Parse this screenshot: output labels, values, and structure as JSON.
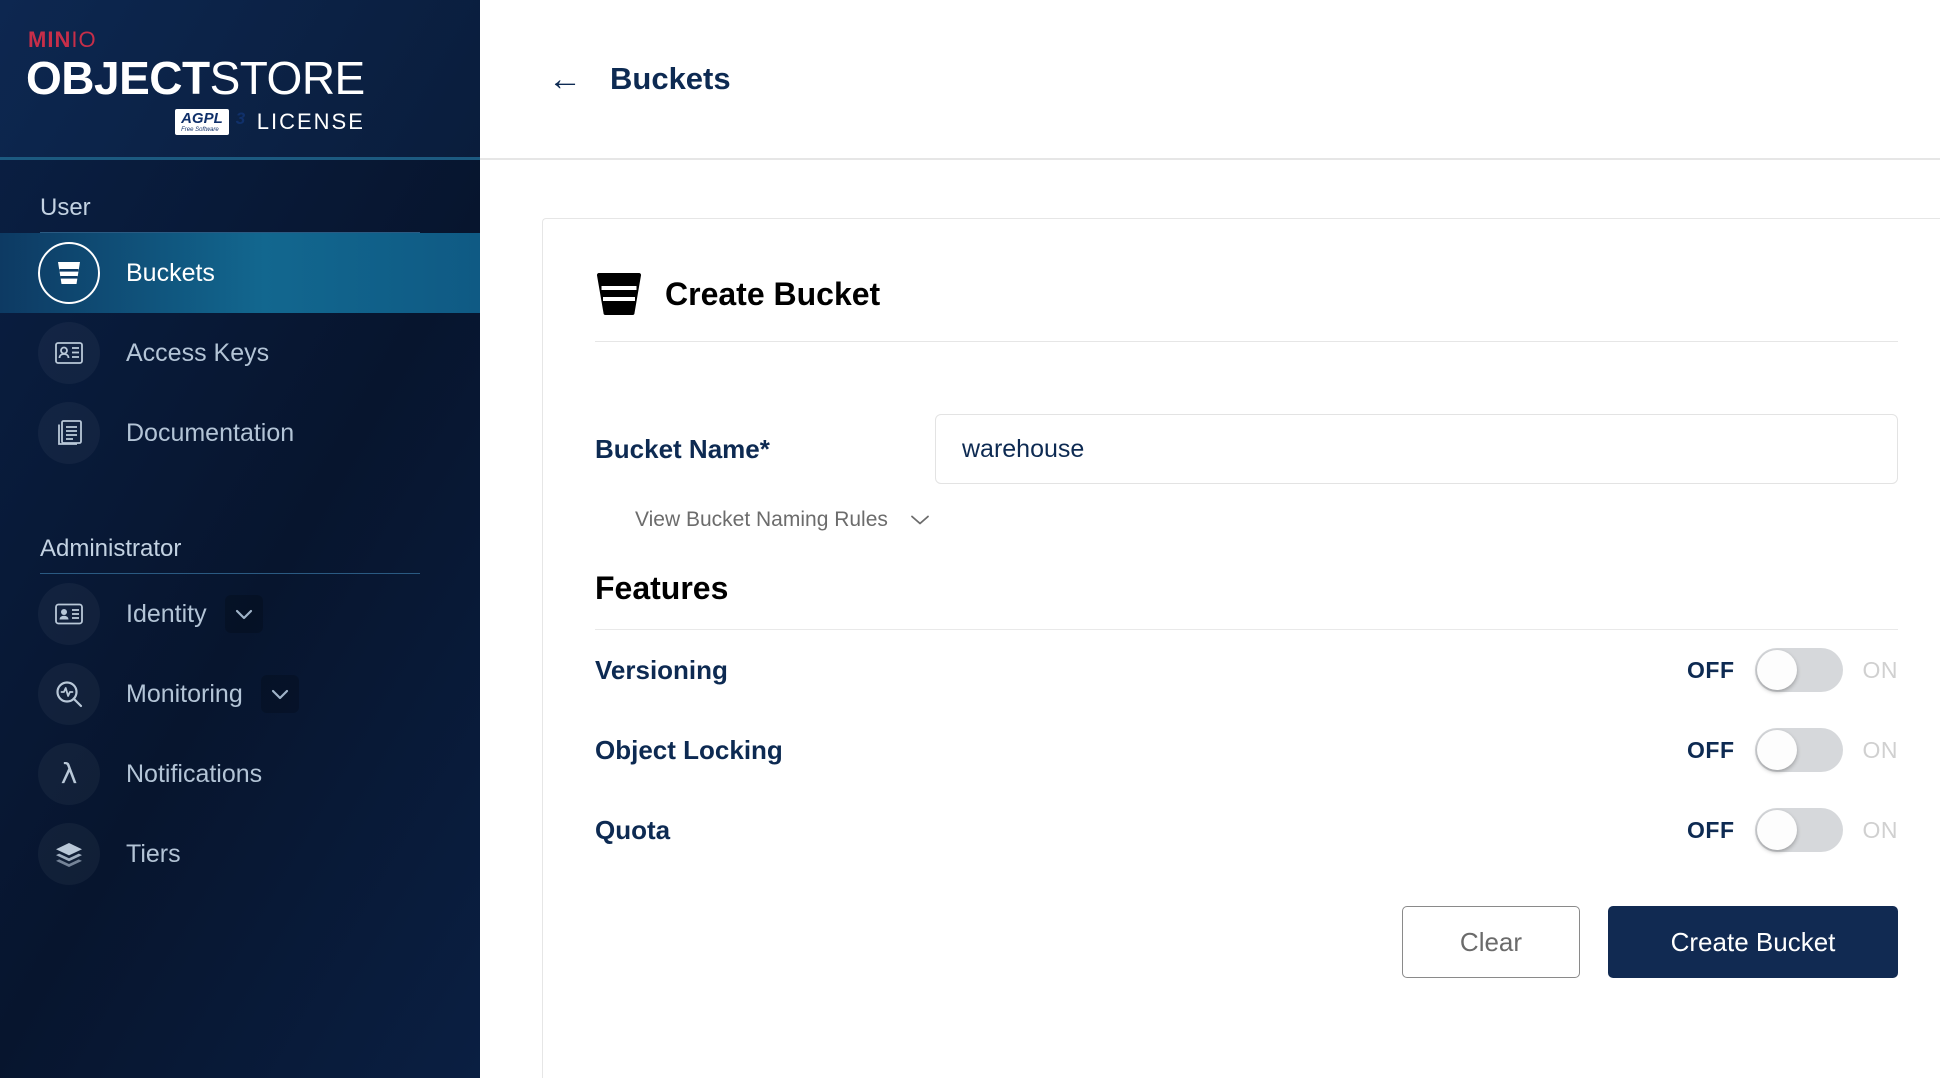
{
  "brand": {
    "product_top": "MIN",
    "product_top_io": "IO",
    "product_bold": "OBJECT",
    "product_thin": "STORE",
    "license_badge_main": "AGPL",
    "license_badge_sub": "Free Software",
    "license_badge_version": "3",
    "license_word": "LICENSE"
  },
  "sidebar": {
    "sections": [
      {
        "title": "User",
        "items": [
          {
            "label": "Buckets",
            "icon": "bucket-icon",
            "active": true,
            "has_chevron": false
          },
          {
            "label": "Access Keys",
            "icon": "access-keys-icon",
            "active": false,
            "has_chevron": false
          },
          {
            "label": "Documentation",
            "icon": "documentation-icon",
            "active": false,
            "has_chevron": false
          }
        ]
      },
      {
        "title": "Administrator",
        "items": [
          {
            "label": "Identity",
            "icon": "identity-icon",
            "active": false,
            "has_chevron": true
          },
          {
            "label": "Monitoring",
            "icon": "monitoring-icon",
            "active": false,
            "has_chevron": true
          },
          {
            "label": "Notifications",
            "icon": "notifications-lambda-icon",
            "active": false,
            "has_chevron": false
          },
          {
            "label": "Tiers",
            "icon": "tiers-layers-icon",
            "active": false,
            "has_chevron": false
          }
        ]
      }
    ]
  },
  "header": {
    "back_arrow": "←",
    "title": "Buckets"
  },
  "panel": {
    "title": "Create Bucket",
    "bucket_name_label": "Bucket Name*",
    "bucket_name_value": "warehouse",
    "bucket_name_placeholder": "",
    "naming_rules_link": "View Bucket Naming Rules",
    "features_title": "Features",
    "features": [
      {
        "label": "Versioning",
        "off_label": "OFF",
        "on_label": "ON",
        "state": "off"
      },
      {
        "label": "Object Locking",
        "off_label": "OFF",
        "on_label": "ON",
        "state": "off"
      },
      {
        "label": "Quota",
        "off_label": "OFF",
        "on_label": "ON",
        "state": "off"
      }
    ],
    "clear_button": "Clear",
    "create_button": "Create Bucket"
  },
  "colors": {
    "sidebar_dark": "#07152e",
    "sidebar_active": "#12678f",
    "navy_text": "#0d2a52",
    "primary_button": "#112a52",
    "accent_red": "#c72e49",
    "toggle_track": "#d6d8db"
  }
}
